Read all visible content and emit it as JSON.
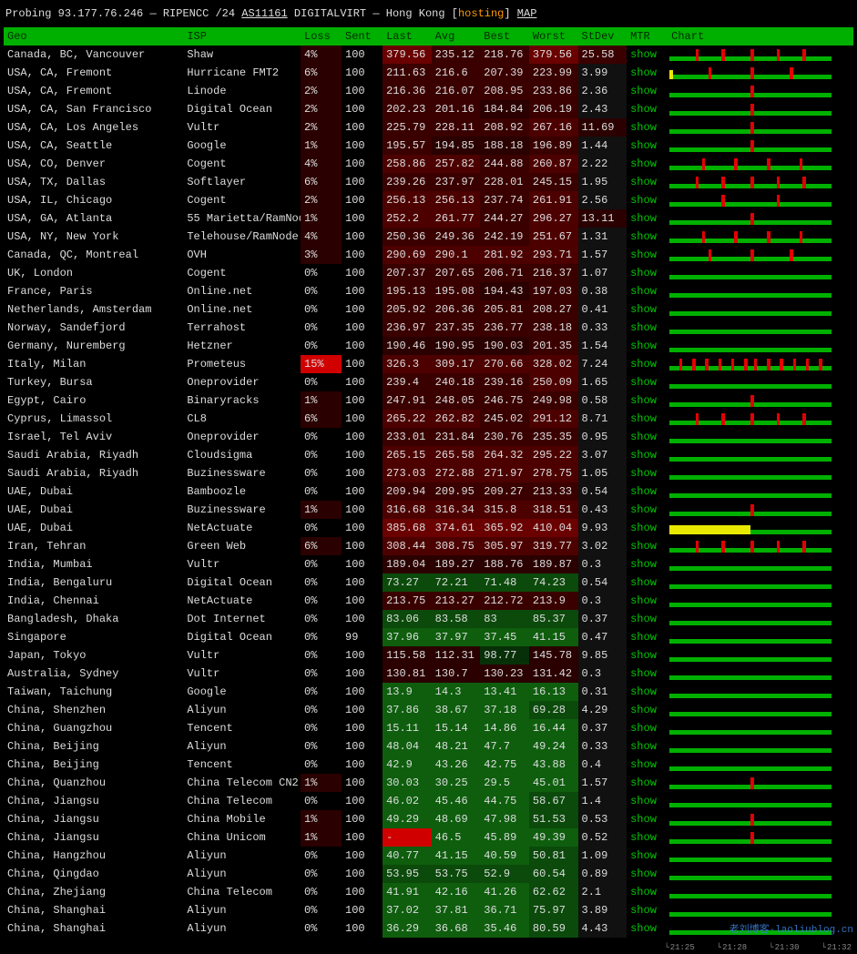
{
  "title": {
    "prefix": "Probing",
    "ip": "93.177.76.246",
    "registry": "RIPENCC",
    "prefix_len": "/24",
    "asn": "AS11161",
    "asn_name": "DIGITALVIRT",
    "location": "Hong Kong",
    "tag": "hosting",
    "map_label": "MAP"
  },
  "columns": {
    "geo": "Geo",
    "isp": "ISP",
    "loss": "Loss",
    "sent": "Sent",
    "last": "Last",
    "avg": "Avg",
    "best": "Best",
    "worst": "Worst",
    "stdev": "StDev",
    "mtr": "MTR",
    "chart": "Chart"
  },
  "mtr_link_label": "show",
  "watermark": "老刘博客-laoliublog.cn",
  "timeticks": [
    "21:25",
    "21:28",
    "21:30",
    "21:32"
  ],
  "rows": [
    {
      "geo": "Canada, BC, Vancouver",
      "isp": "Shaw",
      "loss": "4%",
      "sent": "100",
      "last": "379.56",
      "avg": "235.12",
      "best": "218.76",
      "worst": "379.56",
      "stdev": "25.58",
      "heat": [
        "red4",
        "red2",
        "red2",
        "red4",
        "red2"
      ],
      "spark_red": 5,
      "spark_yel": 0
    },
    {
      "geo": "USA, CA, Fremont",
      "isp": "Hurricane FMT2",
      "loss": "6%",
      "sent": "100",
      "last": "211.63",
      "avg": "216.6",
      "best": "207.39",
      "worst": "223.99",
      "stdev": "3.99",
      "heat": [
        "red2",
        "red2",
        "red2",
        "red2",
        "dark"
      ],
      "spark_red": 3,
      "spark_yel": 1
    },
    {
      "geo": "USA, CA, Fremont",
      "isp": "Linode",
      "loss": "2%",
      "sent": "100",
      "last": "216.36",
      "avg": "216.07",
      "best": "208.95",
      "worst": "233.86",
      "stdev": "2.36",
      "heat": [
        "red2",
        "red2",
        "red2",
        "red2",
        "dark"
      ],
      "spark_red": 1,
      "spark_yel": 0
    },
    {
      "geo": "USA, CA, San Francisco",
      "isp": "Digital Ocean",
      "loss": "2%",
      "sent": "100",
      "last": "202.23",
      "avg": "201.16",
      "best": "184.84",
      "worst": "206.19",
      "stdev": "2.43",
      "heat": [
        "red2",
        "red2",
        "red1",
        "red2",
        "dark"
      ],
      "spark_red": 1,
      "spark_yel": 0
    },
    {
      "geo": "USA, CA, Los Angeles",
      "isp": "Vultr",
      "loss": "2%",
      "sent": "100",
      "last": "225.79",
      "avg": "228.11",
      "best": "208.92",
      "worst": "267.16",
      "stdev": "11.69",
      "heat": [
        "red2",
        "red2",
        "red2",
        "red3",
        "red1"
      ],
      "spark_red": 1,
      "spark_yel": 0
    },
    {
      "geo": "USA, CA, Seattle",
      "isp": "Google",
      "loss": "1%",
      "sent": "100",
      "last": "195.57",
      "avg": "194.85",
      "best": "188.18",
      "worst": "196.89",
      "stdev": "1.44",
      "heat": [
        "red2",
        "red1",
        "red1",
        "red2",
        "dark"
      ],
      "spark_red": 1,
      "spark_yel": 0
    },
    {
      "geo": "USA, CO, Denver",
      "isp": "Cogent",
      "loss": "4%",
      "sent": "100",
      "last": "258.86",
      "avg": "257.82",
      "best": "244.88",
      "worst": "260.87",
      "stdev": "2.22",
      "heat": [
        "red3",
        "red3",
        "red2",
        "red3",
        "dark"
      ],
      "spark_red": 4,
      "spark_yel": 0
    },
    {
      "geo": "USA, TX, Dallas",
      "isp": "Softlayer",
      "loss": "6%",
      "sent": "100",
      "last": "239.26",
      "avg": "237.97",
      "best": "228.01",
      "worst": "245.15",
      "stdev": "1.95",
      "heat": [
        "red2",
        "red2",
        "red2",
        "red2",
        "dark"
      ],
      "spark_red": 5,
      "spark_yel": 0
    },
    {
      "geo": "USA, IL, Chicago",
      "isp": "Cogent",
      "loss": "2%",
      "sent": "100",
      "last": "256.13",
      "avg": "256.13",
      "best": "237.74",
      "worst": "261.91",
      "stdev": "2.56",
      "heat": [
        "red3",
        "red3",
        "red2",
        "red3",
        "dark"
      ],
      "spark_red": 2,
      "spark_yel": 0
    },
    {
      "geo": "USA, GA, Atlanta",
      "isp": "55 Marietta/RamNode",
      "loss": "1%",
      "sent": "100",
      "last": "252.2",
      "avg": "261.77",
      "best": "244.27",
      "worst": "296.27",
      "stdev": "13.11",
      "heat": [
        "red3",
        "red3",
        "red2",
        "red3",
        "red1"
      ],
      "spark_red": 1,
      "spark_yel": 0
    },
    {
      "geo": "USA, NY, New York",
      "isp": "Telehouse/RamNode",
      "loss": "4%",
      "sent": "100",
      "last": "250.36",
      "avg": "249.36",
      "best": "242.19",
      "worst": "251.67",
      "stdev": "1.31",
      "heat": [
        "red2",
        "red2",
        "red2",
        "red3",
        "dark"
      ],
      "spark_red": 4,
      "spark_yel": 0
    },
    {
      "geo": "Canada, QC, Montreal",
      "isp": "OVH",
      "loss": "3%",
      "sent": "100",
      "last": "290.69",
      "avg": "290.1",
      "best": "281.92",
      "worst": "293.71",
      "stdev": "1.57",
      "heat": [
        "red3",
        "red3",
        "red3",
        "red3",
        "dark"
      ],
      "spark_red": 3,
      "spark_yel": 0
    },
    {
      "geo": "UK, London",
      "isp": "Cogent",
      "loss": "0%",
      "sent": "100",
      "last": "207.37",
      "avg": "207.65",
      "best": "206.71",
      "worst": "216.37",
      "stdev": "1.07",
      "heat": [
        "red2",
        "red2",
        "red2",
        "red2",
        "dark"
      ],
      "spark_red": 0,
      "spark_yel": 0
    },
    {
      "geo": "France, Paris",
      "isp": "Online.net",
      "loss": "0%",
      "sent": "100",
      "last": "195.13",
      "avg": "195.08",
      "best": "194.43",
      "worst": "197.03",
      "stdev": "0.38",
      "heat": [
        "red2",
        "red2",
        "red1",
        "red2",
        "dark"
      ],
      "spark_red": 0,
      "spark_yel": 0
    },
    {
      "geo": "Netherlands, Amsterdam",
      "isp": "Online.net",
      "loss": "0%",
      "sent": "100",
      "last": "205.92",
      "avg": "206.36",
      "best": "205.81",
      "worst": "208.27",
      "stdev": "0.41",
      "heat": [
        "red2",
        "red2",
        "red2",
        "red2",
        "dark"
      ],
      "spark_red": 0,
      "spark_yel": 0
    },
    {
      "geo": "Norway, Sandefjord",
      "isp": "Terrahost",
      "loss": "0%",
      "sent": "100",
      "last": "236.97",
      "avg": "237.35",
      "best": "236.77",
      "worst": "238.18",
      "stdev": "0.33",
      "heat": [
        "red2",
        "red2",
        "red2",
        "red2",
        "dark"
      ],
      "spark_red": 0,
      "spark_yel": 0
    },
    {
      "geo": "Germany, Nuremberg",
      "isp": "Hetzner",
      "loss": "0%",
      "sent": "100",
      "last": "190.46",
      "avg": "190.95",
      "best": "190.03",
      "worst": "201.35",
      "stdev": "1.54",
      "heat": [
        "red1",
        "red1",
        "red1",
        "red2",
        "dark"
      ],
      "spark_red": 0,
      "spark_yel": 0
    },
    {
      "geo": "Italy, Milan",
      "isp": "Prometeus",
      "loss": "15%",
      "sent": "100",
      "last": "326.3",
      "avg": "309.17",
      "best": "270.66",
      "worst": "328.02",
      "stdev": "7.24",
      "heat": [
        "red3",
        "red3",
        "red3",
        "red3",
        "dark"
      ],
      "loss_heat": "brightred",
      "spark_red": 12,
      "spark_yel": 0
    },
    {
      "geo": "Turkey, Bursa",
      "isp": "Oneprovider",
      "loss": "0%",
      "sent": "100",
      "last": "239.4",
      "avg": "240.18",
      "best": "239.16",
      "worst": "250.09",
      "stdev": "1.65",
      "heat": [
        "red2",
        "red2",
        "red2",
        "red3",
        "dark"
      ],
      "spark_red": 0,
      "spark_yel": 0
    },
    {
      "geo": "Egypt, Cairo",
      "isp": "Binaryracks",
      "loss": "1%",
      "sent": "100",
      "last": "247.91",
      "avg": "248.05",
      "best": "246.75",
      "worst": "249.98",
      "stdev": "0.58",
      "heat": [
        "red2",
        "red2",
        "red2",
        "red2",
        "dark"
      ],
      "spark_red": 1,
      "spark_yel": 0
    },
    {
      "geo": "Cyprus, Limassol",
      "isp": "CL8",
      "loss": "6%",
      "sent": "100",
      "last": "265.22",
      "avg": "262.82",
      "best": "245.02",
      "worst": "291.12",
      "stdev": "8.71",
      "heat": [
        "red3",
        "red3",
        "red2",
        "red3",
        "dark"
      ],
      "spark_red": 5,
      "spark_yel": 0
    },
    {
      "geo": "Israel, Tel Aviv",
      "isp": "Oneprovider",
      "loss": "0%",
      "sent": "100",
      "last": "233.01",
      "avg": "231.84",
      "best": "230.76",
      "worst": "235.35",
      "stdev": "0.95",
      "heat": [
        "red2",
        "red2",
        "red2",
        "red2",
        "dark"
      ],
      "spark_red": 0,
      "spark_yel": 0
    },
    {
      "geo": "Saudi Arabia, Riyadh",
      "isp": "Cloudsigma",
      "loss": "0%",
      "sent": "100",
      "last": "265.15",
      "avg": "265.58",
      "best": "264.32",
      "worst": "295.22",
      "stdev": "3.07",
      "heat": [
        "red3",
        "red3",
        "red3",
        "red3",
        "dark"
      ],
      "spark_red": 0,
      "spark_yel": 0
    },
    {
      "geo": "Saudi Arabia, Riyadh",
      "isp": "Buzinessware",
      "loss": "0%",
      "sent": "100",
      "last": "273.03",
      "avg": "272.88",
      "best": "271.97",
      "worst": "278.75",
      "stdev": "1.05",
      "heat": [
        "red3",
        "red3",
        "red3",
        "red3",
        "dark"
      ],
      "spark_red": 0,
      "spark_yel": 0
    },
    {
      "geo": "UAE, Dubai",
      "isp": "Bamboozle",
      "loss": "0%",
      "sent": "100",
      "last": "209.94",
      "avg": "209.95",
      "best": "209.27",
      "worst": "213.33",
      "stdev": "0.54",
      "heat": [
        "red2",
        "red2",
        "red2",
        "red2",
        "dark"
      ],
      "spark_red": 0,
      "spark_yel": 0
    },
    {
      "geo": "UAE, Dubai",
      "isp": "Buzinessware",
      "loss": "1%",
      "sent": "100",
      "last": "316.68",
      "avg": "316.34",
      "best": "315.8",
      "worst": "318.51",
      "stdev": "0.43",
      "heat": [
        "red3",
        "red3",
        "red3",
        "red3",
        "dark"
      ],
      "spark_red": 1,
      "spark_yel": 0
    },
    {
      "geo": "UAE, Dubai",
      "isp": "NetActuate",
      "loss": "0%",
      "sent": "100",
      "last": "385.68",
      "avg": "374.61",
      "best": "365.92",
      "worst": "410.04",
      "stdev": "9.93",
      "heat": [
        "red4",
        "red4",
        "red4",
        "red4",
        "dark"
      ],
      "spark_red": 0,
      "spark_yel": 25
    },
    {
      "geo": "Iran, Tehran",
      "isp": "Green Web",
      "loss": "6%",
      "sent": "100",
      "last": "308.44",
      "avg": "308.75",
      "best": "305.97",
      "worst": "319.77",
      "stdev": "3.02",
      "heat": [
        "red3",
        "red3",
        "red3",
        "red3",
        "dark"
      ],
      "spark_red": 5,
      "spark_yel": 0
    },
    {
      "geo": "India, Mumbai",
      "isp": "Vultr",
      "loss": "0%",
      "sent": "100",
      "last": "189.04",
      "avg": "189.27",
      "best": "188.76",
      "worst": "189.87",
      "stdev": "0.3",
      "heat": [
        "red1",
        "red1",
        "red1",
        "red1",
        "dark"
      ],
      "spark_red": 0,
      "spark_yel": 0
    },
    {
      "geo": "India, Bengaluru",
      "isp": "Digital Ocean",
      "loss": "0%",
      "sent": "100",
      "last": "73.27",
      "avg": "72.21",
      "best": "71.48",
      "worst": "74.23",
      "stdev": "0.54",
      "heat": [
        "g2",
        "g2",
        "g2",
        "g2",
        "dark"
      ],
      "spark_red": 0,
      "spark_yel": 0
    },
    {
      "geo": "India, Chennai",
      "isp": "NetActuate",
      "loss": "0%",
      "sent": "100",
      "last": "213.75",
      "avg": "213.27",
      "best": "212.72",
      "worst": "213.9",
      "stdev": "0.3",
      "heat": [
        "red2",
        "red2",
        "red2",
        "red2",
        "dark"
      ],
      "spark_red": 0,
      "spark_yel": 0
    },
    {
      "geo": "Bangladesh, Dhaka",
      "isp": "Dot Internet",
      "loss": "0%",
      "sent": "100",
      "last": "83.06",
      "avg": "83.58",
      "best": "83",
      "worst": "85.37",
      "stdev": "0.37",
      "heat": [
        "g2",
        "g2",
        "g2",
        "g2",
        "dark"
      ],
      "spark_red": 0,
      "spark_yel": 0
    },
    {
      "geo": "Singapore",
      "isp": "Digital Ocean",
      "loss": "0%",
      "sent": "99",
      "last": "37.96",
      "avg": "37.97",
      "best": "37.45",
      "worst": "41.15",
      "stdev": "0.47",
      "heat": [
        "g3",
        "g3",
        "g3",
        "g3",
        "dark"
      ],
      "spark_red": 0,
      "spark_yel": 0
    },
    {
      "geo": "Japan, Tokyo",
      "isp": "Vultr",
      "loss": "0%",
      "sent": "100",
      "last": "115.58",
      "avg": "112.31",
      "best": "98.77",
      "worst": "145.78",
      "stdev": "9.85",
      "heat": [
        "red1",
        "red1",
        "g1",
        "red1",
        "dark"
      ],
      "spark_red": 0,
      "spark_yel": 0
    },
    {
      "geo": "Australia, Sydney",
      "isp": "Vultr",
      "loss": "0%",
      "sent": "100",
      "last": "130.81",
      "avg": "130.7",
      "best": "130.23",
      "worst": "131.42",
      "stdev": "0.3",
      "heat": [
        "red1",
        "red1",
        "red1",
        "red1",
        "dark"
      ],
      "spark_red": 0,
      "spark_yel": 0
    },
    {
      "geo": "Taiwan, Taichung",
      "isp": "Google",
      "loss": "0%",
      "sent": "100",
      "last": "13.9",
      "avg": "14.3",
      "best": "13.41",
      "worst": "16.13",
      "stdev": "0.31",
      "heat": [
        "g3",
        "g3",
        "g3",
        "g3",
        "dark"
      ],
      "spark_red": 0,
      "spark_yel": 0
    },
    {
      "geo": "China, Shenzhen",
      "isp": "Aliyun",
      "loss": "0%",
      "sent": "100",
      "last": "37.86",
      "avg": "38.67",
      "best": "37.18",
      "worst": "69.28",
      "stdev": "4.29",
      "heat": [
        "g3",
        "g3",
        "g3",
        "g2",
        "dark"
      ],
      "spark_red": 0,
      "spark_yel": 0
    },
    {
      "geo": "China, Guangzhou",
      "isp": "Tencent",
      "loss": "0%",
      "sent": "100",
      "last": "15.11",
      "avg": "15.14",
      "best": "14.86",
      "worst": "16.44",
      "stdev": "0.37",
      "heat": [
        "g3",
        "g3",
        "g3",
        "g3",
        "dark"
      ],
      "spark_red": 0,
      "spark_yel": 0
    },
    {
      "geo": "China, Beijing",
      "isp": "Aliyun",
      "loss": "0%",
      "sent": "100",
      "last": "48.04",
      "avg": "48.21",
      "best": "47.7",
      "worst": "49.24",
      "stdev": "0.33",
      "heat": [
        "g3",
        "g3",
        "g3",
        "g3",
        "dark"
      ],
      "spark_red": 0,
      "spark_yel": 0
    },
    {
      "geo": "China, Beijing",
      "isp": "Tencent",
      "loss": "0%",
      "sent": "100",
      "last": "42.9",
      "avg": "43.26",
      "best": "42.75",
      "worst": "43.88",
      "stdev": "0.4",
      "heat": [
        "g3",
        "g3",
        "g3",
        "g3",
        "dark"
      ],
      "spark_red": 0,
      "spark_yel": 0
    },
    {
      "geo": "China, Quanzhou",
      "isp": "China Telecom CN2",
      "loss": "1%",
      "sent": "100",
      "last": "30.03",
      "avg": "30.25",
      "best": "29.5",
      "worst": "45.01",
      "stdev": "1.57",
      "heat": [
        "g3",
        "g3",
        "g3",
        "g3",
        "dark"
      ],
      "spark_red": 1,
      "spark_yel": 0
    },
    {
      "geo": "China, Jiangsu",
      "isp": "China Telecom",
      "loss": "0%",
      "sent": "100",
      "last": "46.02",
      "avg": "45.46",
      "best": "44.75",
      "worst": "58.67",
      "stdev": "1.4",
      "heat": [
        "g3",
        "g3",
        "g3",
        "g2",
        "dark"
      ],
      "spark_red": 0,
      "spark_yel": 0
    },
    {
      "geo": "China, Jiangsu",
      "isp": "China Mobile",
      "loss": "1%",
      "sent": "100",
      "last": "49.29",
      "avg": "48.69",
      "best": "47.98",
      "worst": "51.53",
      "stdev": "0.53",
      "heat": [
        "g3",
        "g3",
        "g3",
        "g2",
        "dark"
      ],
      "spark_red": 1,
      "spark_yel": 0
    },
    {
      "geo": "China, Jiangsu",
      "isp": "China Unicom",
      "loss": "1%",
      "sent": "100",
      "last": "-",
      "avg": "46.5",
      "best": "45.89",
      "worst": "49.39",
      "stdev": "0.52",
      "heat": [
        "brightred",
        "g3",
        "g3",
        "g3",
        "dark"
      ],
      "spark_red": 1,
      "spark_yel": 0
    },
    {
      "geo": "China, Hangzhou",
      "isp": "Aliyun",
      "loss": "0%",
      "sent": "100",
      "last": "40.77",
      "avg": "41.15",
      "best": "40.59",
      "worst": "50.81",
      "stdev": "1.09",
      "heat": [
        "g3",
        "g3",
        "g3",
        "g2",
        "dark"
      ],
      "spark_red": 0,
      "spark_yel": 0
    },
    {
      "geo": "China, Qingdao",
      "isp": "Aliyun",
      "loss": "0%",
      "sent": "100",
      "last": "53.95",
      "avg": "53.75",
      "best": "52.9",
      "worst": "60.54",
      "stdev": "0.89",
      "heat": [
        "g2",
        "g2",
        "g2",
        "g2",
        "dark"
      ],
      "spark_red": 0,
      "spark_yel": 0
    },
    {
      "geo": "China, Zhejiang",
      "isp": "China Telecom",
      "loss": "0%",
      "sent": "100",
      "last": "41.91",
      "avg": "42.16",
      "best": "41.26",
      "worst": "62.62",
      "stdev": "2.1",
      "heat": [
        "g3",
        "g3",
        "g3",
        "g2",
        "dark"
      ],
      "spark_red": 0,
      "spark_yel": 0
    },
    {
      "geo": "China, Shanghai",
      "isp": "Aliyun",
      "loss": "0%",
      "sent": "100",
      "last": "37.02",
      "avg": "37.81",
      "best": "36.71",
      "worst": "75.97",
      "stdev": "3.89",
      "heat": [
        "g3",
        "g3",
        "g3",
        "g2",
        "dark"
      ],
      "spark_red": 0,
      "spark_yel": 0
    },
    {
      "geo": "China, Shanghai",
      "isp": "Aliyun",
      "loss": "0%",
      "sent": "100",
      "last": "36.29",
      "avg": "36.68",
      "best": "35.46",
      "worst": "80.59",
      "stdev": "4.43",
      "heat": [
        "g3",
        "g3",
        "g3",
        "g2",
        "dark"
      ],
      "spark_red": 0,
      "spark_yel": 0
    }
  ]
}
